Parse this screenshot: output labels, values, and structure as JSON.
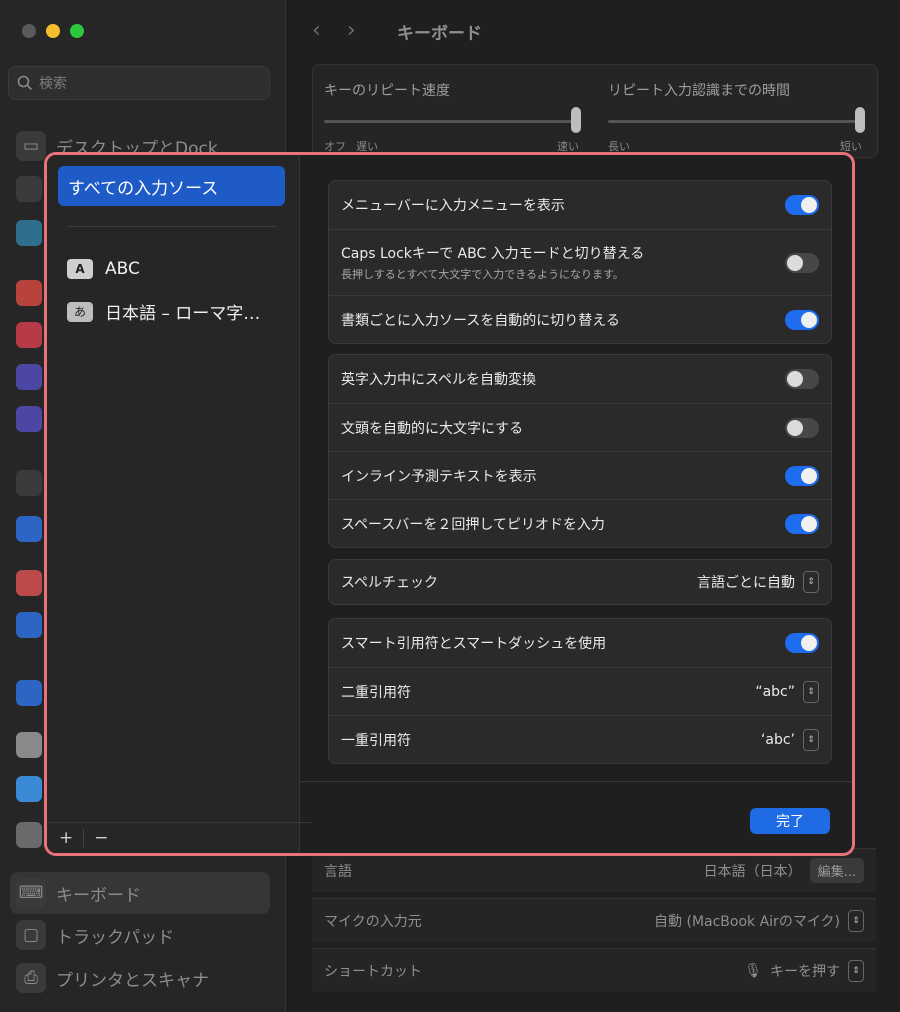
{
  "window": {
    "title": "キーボード"
  },
  "search": {
    "placeholder": "検索"
  },
  "sidebar_bg": {
    "desktop_dock": "デスクトップとDock",
    "keyboard": "キーボード",
    "trackpad": "トラックパッド",
    "printers": "プリンタとスキャナ"
  },
  "bg_main": {
    "repeat_rate_label": "キーのリピート速度",
    "delay_label": "リピート入力認識までの時間",
    "repeat_off": "オフ",
    "repeat_slow": "遅い",
    "repeat_fast": "速い",
    "delay_long": "長い",
    "delay_short": "短い",
    "language_label": "言語",
    "language_value": "日本語（日本）",
    "edit_button": "編集...",
    "mic_label": "マイクの入力元",
    "mic_value": "自動 (MacBook Airのマイク)",
    "shortcut_label": "ショートカット",
    "shortcut_value": "キーを押す"
  },
  "modal": {
    "all_sources": "すべての入力ソース",
    "sources": [
      {
        "badge": "A",
        "label": "ABC"
      },
      {
        "badge": "あ",
        "label": "日本語 – ローマ字…"
      }
    ],
    "add": "+",
    "remove": "−",
    "group1": [
      {
        "label": "メニューバーに入力メニューを表示",
        "on": true
      },
      {
        "label": "Caps Lockキーで ABC 入力モードと切り替える",
        "sub": "長押しするとすべて大文字で入力できるようになります。",
        "on": false
      },
      {
        "label": "書類ごとに入力ソースを自動的に切り替える",
        "on": true
      }
    ],
    "group2": [
      {
        "label": "英字入力中にスペルを自動変換",
        "on": false
      },
      {
        "label": "文頭を自動的に大文字にする",
        "on": false
      },
      {
        "label": "インライン予測テキストを表示",
        "on": true
      },
      {
        "label": "スペースバーを２回押してピリオドを入力",
        "on": true
      }
    ],
    "spell_label": "スペルチェック",
    "spell_value": "言語ごとに自動",
    "smart_label": "スマート引用符とスマートダッシュを使用",
    "smart_on": true,
    "double_label": "二重引用符",
    "double_value": "“abc”",
    "single_label": "一重引用符",
    "single_value": "‘abc’",
    "done": "完了"
  },
  "colors": {
    "accent": "#1f6be6",
    "highlight_border": "#e8737a",
    "selection": "#1f5bc6"
  }
}
